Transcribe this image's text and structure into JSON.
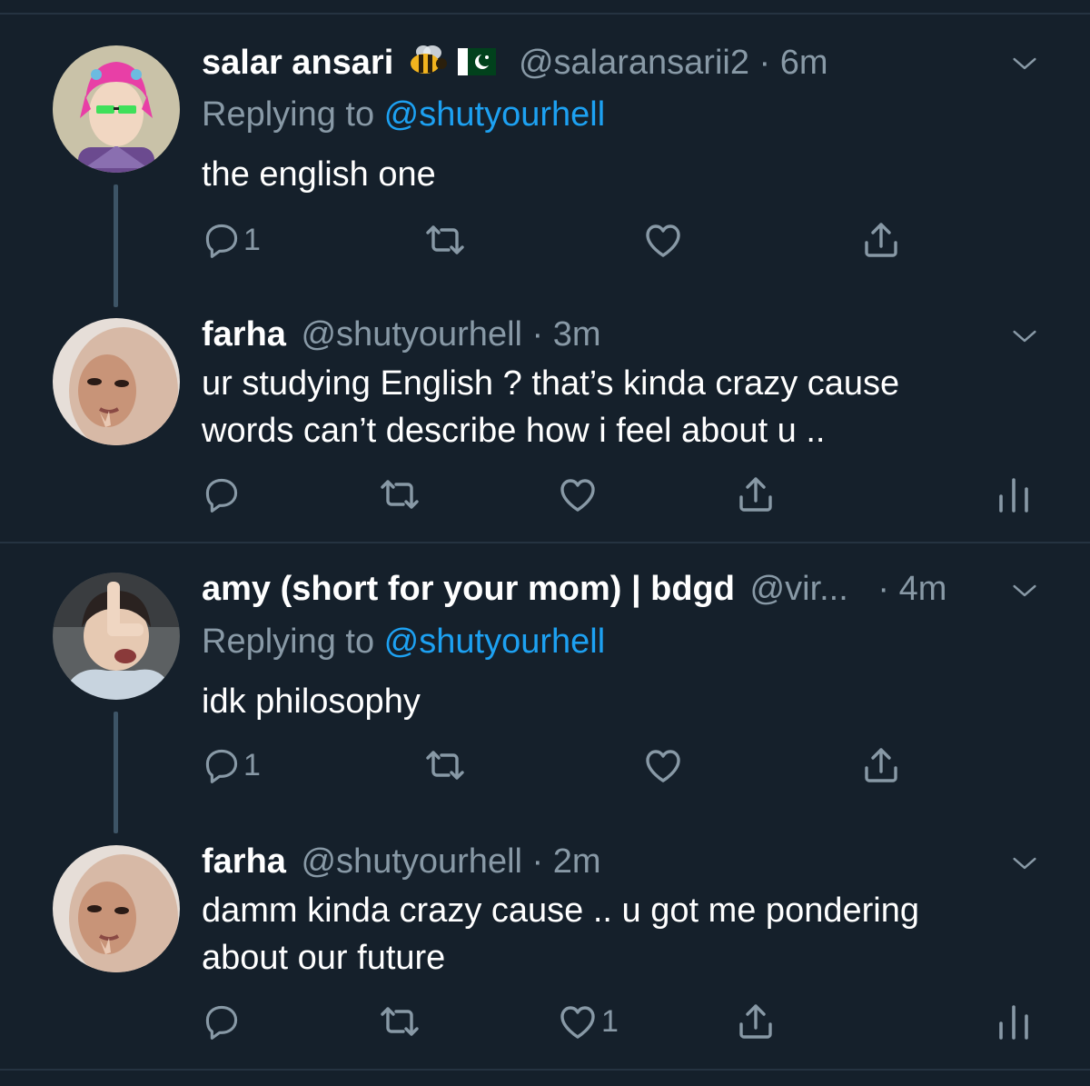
{
  "tweets": [
    {
      "name": "salar ansari",
      "emoji": [
        "bee-emoji",
        "pakistan-flag-emoji"
      ],
      "handle": "@salaransarii2",
      "dot": "·",
      "time": "6m",
      "replying_prefix": "Replying to ",
      "replying_to": "@shutyourhell",
      "text": "the english one",
      "reply_count": "1"
    },
    {
      "name": "farha",
      "handle": "@shutyourhell",
      "dot": "·",
      "time": "3m",
      "text_line1": "ur studying English ? that’s kinda crazy cause",
      "text_line2": "words can’t describe how i feel about u .."
    },
    {
      "name": "amy (short for your mom) | bdgd",
      "handle": "@vir...",
      "dot": "·",
      "time": "4m",
      "replying_prefix": "Replying to ",
      "replying_to": "@shutyourhell",
      "text": "idk philosophy",
      "reply_count": "1"
    },
    {
      "name": "farha",
      "handle": "@shutyourhell",
      "dot": "·",
      "time": "2m",
      "text_line1": "damm kinda crazy cause .. u got me pondering",
      "text_line2": "about our future",
      "like_count": "1"
    }
  ],
  "icons": {
    "reply": "reply-icon",
    "retweet": "retweet-icon",
    "like": "heart-icon",
    "share": "share-icon",
    "analytics": "analytics-icon",
    "more": "chevron-down-icon"
  },
  "colors": {
    "background": "#15202b",
    "text": "#ffffff",
    "secondary": "#8899a6",
    "link": "#1da1f2",
    "divider": "#253341"
  }
}
